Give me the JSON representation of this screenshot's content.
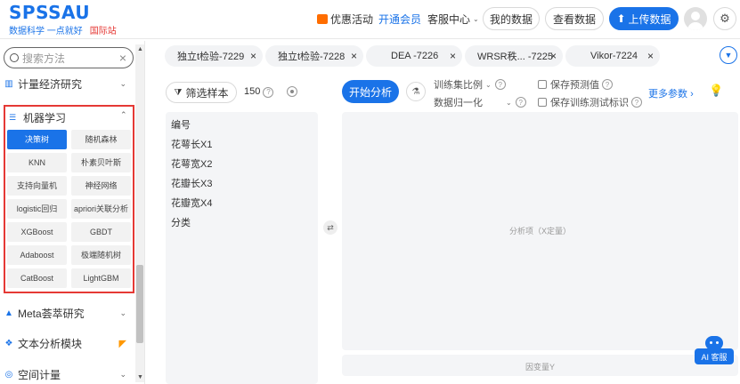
{
  "brand": {
    "name": "SPSSAU",
    "slogan": "数据科学 一点就好",
    "intl": "国际站"
  },
  "topnav": {
    "promo": "优惠活动",
    "vip": "开通会员",
    "service": "客服中心",
    "my_data": "我的数据",
    "view_data": "查看数据",
    "upload": "上传数据"
  },
  "sidebar": {
    "search_placeholder": "搜索方法",
    "items": [
      {
        "label": "计量经济研究"
      },
      {
        "label": "Meta荟萃研究"
      },
      {
        "label": "文本分析模块"
      },
      {
        "label": "空间计量"
      }
    ],
    "ml": {
      "title": "机器学习",
      "algorithms": [
        {
          "label": "决策树",
          "active": true
        },
        {
          "label": "随机森林"
        },
        {
          "label": "KNN"
        },
        {
          "label": "朴素贝叶斯"
        },
        {
          "label": "支持向量机"
        },
        {
          "label": "神经网络"
        },
        {
          "label": "logistic回归"
        },
        {
          "label": "apriori关联分析"
        },
        {
          "label": "XGBoost"
        },
        {
          "label": "GBDT"
        },
        {
          "label": "Adaboost"
        },
        {
          "label": "极端随机树"
        },
        {
          "label": "CatBoost"
        },
        {
          "label": "LightGBM"
        }
      ]
    }
  },
  "tabs": [
    {
      "label": "独立t检验-7229"
    },
    {
      "label": "独立t检验-7228"
    },
    {
      "label": "DEA -7226"
    },
    {
      "label": "WRSR秩... -7225"
    },
    {
      "label": "Vikor-7224"
    }
  ],
  "workspace": {
    "filter_label": "筛选样本",
    "sample_count": "150",
    "variables": [
      "编号",
      "花萼长X1",
      "花萼宽X2",
      "花瓣长X3",
      "花瓣宽X4",
      "分类"
    ],
    "start_label": "开始分析",
    "train_ratio_label": "训练集比例",
    "normalize_label": "数据归一化",
    "save_pred_label": "保存预测值",
    "save_train_label": "保存训练测试标识",
    "more_params_label": "更多参数",
    "x_zone_label": "分析项（X定量）",
    "y_zone_label": "因变量Y",
    "ai_label": "AI 客服"
  },
  "colors": {
    "accent": "#1a73e8",
    "highlight_border": "#e53935"
  }
}
